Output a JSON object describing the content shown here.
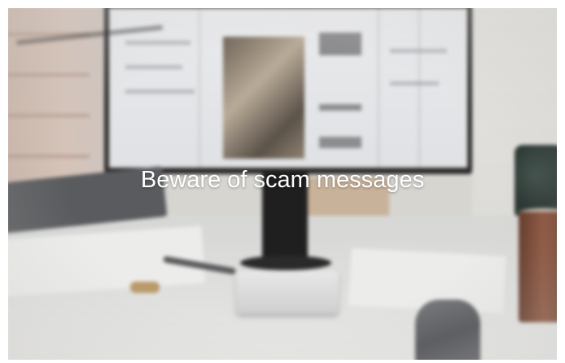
{
  "caption": {
    "text": "Beware of scam messages",
    "color": "#ffffff"
  },
  "scene": {
    "description_colors": {
      "background": "#d9d5cf",
      "monitor_frame": "#2c2b2a",
      "mug": "#8a4f37"
    }
  }
}
